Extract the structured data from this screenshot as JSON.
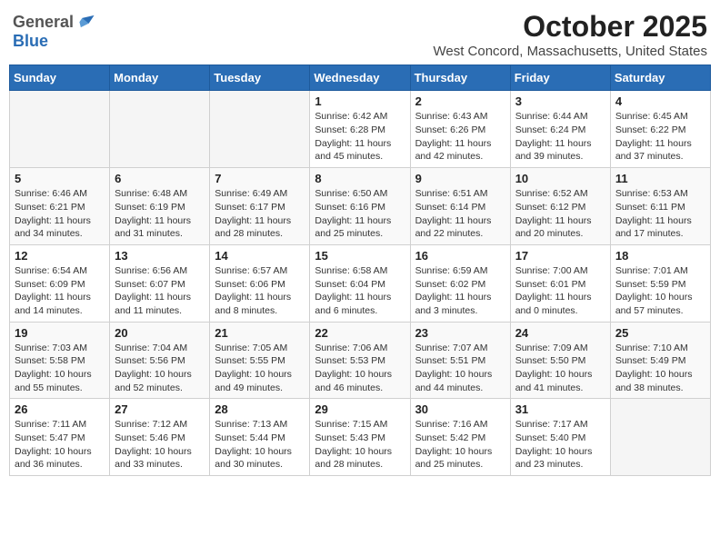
{
  "header": {
    "logo_general": "General",
    "logo_blue": "Blue",
    "month": "October 2025",
    "location": "West Concord, Massachusetts, United States"
  },
  "days_of_week": [
    "Sunday",
    "Monday",
    "Tuesday",
    "Wednesday",
    "Thursday",
    "Friday",
    "Saturday"
  ],
  "weeks": [
    [
      {
        "day": "",
        "info": ""
      },
      {
        "day": "",
        "info": ""
      },
      {
        "day": "",
        "info": ""
      },
      {
        "day": "1",
        "info": "Sunrise: 6:42 AM\nSunset: 6:28 PM\nDaylight: 11 hours\nand 45 minutes."
      },
      {
        "day": "2",
        "info": "Sunrise: 6:43 AM\nSunset: 6:26 PM\nDaylight: 11 hours\nand 42 minutes."
      },
      {
        "day": "3",
        "info": "Sunrise: 6:44 AM\nSunset: 6:24 PM\nDaylight: 11 hours\nand 39 minutes."
      },
      {
        "day": "4",
        "info": "Sunrise: 6:45 AM\nSunset: 6:22 PM\nDaylight: 11 hours\nand 37 minutes."
      }
    ],
    [
      {
        "day": "5",
        "info": "Sunrise: 6:46 AM\nSunset: 6:21 PM\nDaylight: 11 hours\nand 34 minutes."
      },
      {
        "day": "6",
        "info": "Sunrise: 6:48 AM\nSunset: 6:19 PM\nDaylight: 11 hours\nand 31 minutes."
      },
      {
        "day": "7",
        "info": "Sunrise: 6:49 AM\nSunset: 6:17 PM\nDaylight: 11 hours\nand 28 minutes."
      },
      {
        "day": "8",
        "info": "Sunrise: 6:50 AM\nSunset: 6:16 PM\nDaylight: 11 hours\nand 25 minutes."
      },
      {
        "day": "9",
        "info": "Sunrise: 6:51 AM\nSunset: 6:14 PM\nDaylight: 11 hours\nand 22 minutes."
      },
      {
        "day": "10",
        "info": "Sunrise: 6:52 AM\nSunset: 6:12 PM\nDaylight: 11 hours\nand 20 minutes."
      },
      {
        "day": "11",
        "info": "Sunrise: 6:53 AM\nSunset: 6:11 PM\nDaylight: 11 hours\nand 17 minutes."
      }
    ],
    [
      {
        "day": "12",
        "info": "Sunrise: 6:54 AM\nSunset: 6:09 PM\nDaylight: 11 hours\nand 14 minutes."
      },
      {
        "day": "13",
        "info": "Sunrise: 6:56 AM\nSunset: 6:07 PM\nDaylight: 11 hours\nand 11 minutes."
      },
      {
        "day": "14",
        "info": "Sunrise: 6:57 AM\nSunset: 6:06 PM\nDaylight: 11 hours\nand 8 minutes."
      },
      {
        "day": "15",
        "info": "Sunrise: 6:58 AM\nSunset: 6:04 PM\nDaylight: 11 hours\nand 6 minutes."
      },
      {
        "day": "16",
        "info": "Sunrise: 6:59 AM\nSunset: 6:02 PM\nDaylight: 11 hours\nand 3 minutes."
      },
      {
        "day": "17",
        "info": "Sunrise: 7:00 AM\nSunset: 6:01 PM\nDaylight: 11 hours\nand 0 minutes."
      },
      {
        "day": "18",
        "info": "Sunrise: 7:01 AM\nSunset: 5:59 PM\nDaylight: 10 hours\nand 57 minutes."
      }
    ],
    [
      {
        "day": "19",
        "info": "Sunrise: 7:03 AM\nSunset: 5:58 PM\nDaylight: 10 hours\nand 55 minutes."
      },
      {
        "day": "20",
        "info": "Sunrise: 7:04 AM\nSunset: 5:56 PM\nDaylight: 10 hours\nand 52 minutes."
      },
      {
        "day": "21",
        "info": "Sunrise: 7:05 AM\nSunset: 5:55 PM\nDaylight: 10 hours\nand 49 minutes."
      },
      {
        "day": "22",
        "info": "Sunrise: 7:06 AM\nSunset: 5:53 PM\nDaylight: 10 hours\nand 46 minutes."
      },
      {
        "day": "23",
        "info": "Sunrise: 7:07 AM\nSunset: 5:51 PM\nDaylight: 10 hours\nand 44 minutes."
      },
      {
        "day": "24",
        "info": "Sunrise: 7:09 AM\nSunset: 5:50 PM\nDaylight: 10 hours\nand 41 minutes."
      },
      {
        "day": "25",
        "info": "Sunrise: 7:10 AM\nSunset: 5:49 PM\nDaylight: 10 hours\nand 38 minutes."
      }
    ],
    [
      {
        "day": "26",
        "info": "Sunrise: 7:11 AM\nSunset: 5:47 PM\nDaylight: 10 hours\nand 36 minutes."
      },
      {
        "day": "27",
        "info": "Sunrise: 7:12 AM\nSunset: 5:46 PM\nDaylight: 10 hours\nand 33 minutes."
      },
      {
        "day": "28",
        "info": "Sunrise: 7:13 AM\nSunset: 5:44 PM\nDaylight: 10 hours\nand 30 minutes."
      },
      {
        "day": "29",
        "info": "Sunrise: 7:15 AM\nSunset: 5:43 PM\nDaylight: 10 hours\nand 28 minutes."
      },
      {
        "day": "30",
        "info": "Sunrise: 7:16 AM\nSunset: 5:42 PM\nDaylight: 10 hours\nand 25 minutes."
      },
      {
        "day": "31",
        "info": "Sunrise: 7:17 AM\nSunset: 5:40 PM\nDaylight: 10 hours\nand 23 minutes."
      },
      {
        "day": "",
        "info": ""
      }
    ]
  ]
}
